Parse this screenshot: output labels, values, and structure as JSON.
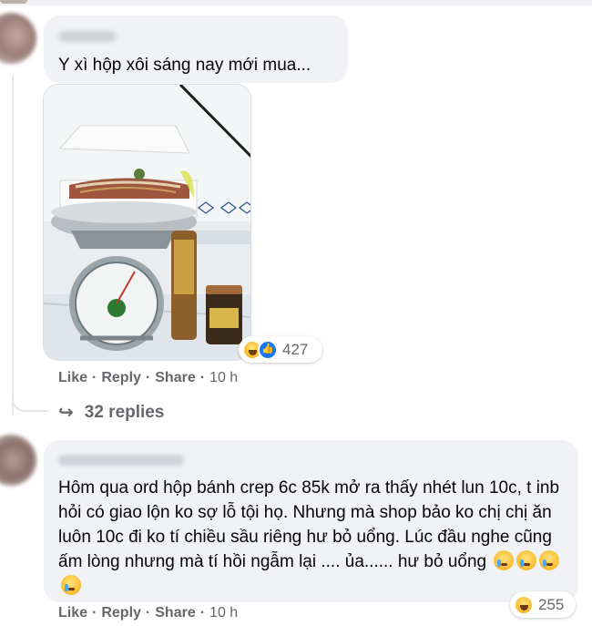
{
  "comments": [
    {
      "text": "Y xì hộp xôi sáng nay mới mua...",
      "reaction_count": "427",
      "reactions": [
        "haha-icon",
        "like-icon"
      ],
      "actions": {
        "like": "Like",
        "reply": "Reply",
        "share": "Share",
        "time": "10 h"
      },
      "replies_label": "32 replies"
    },
    {
      "text": "Hôm qua ord hộp bánh crep 6c 85k mở ra thấy nhét lun 10c, t inb hỏi có giao lộn ko sợ lỗ tội họ. Nhưng mà shop bảo ko chị chị ăn luôn 10c đi ko tí chiều sầu riêng hư bỏ uổng. Lúc đầu nghe cũng ấm lòng nhưng mà tí hồi ngẫm lại .... ủa...... hư bỏ uổng",
      "trailing_emoji": [
        "crying-face-icon",
        "crying-face-icon",
        "crying-face-icon",
        "crying-face-icon"
      ],
      "reaction_count": "255",
      "reactions": [
        "haha-icon"
      ],
      "actions": {
        "like": "Like",
        "reply": "Reply",
        "share": "Share",
        "time": "10 h"
      }
    }
  ],
  "dot": "·",
  "colors": {
    "bubble": "#f0f2f5",
    "meta": "#65676b",
    "text": "#050505",
    "like_blue": "#1877f2",
    "haha_yellow": "#f7b928"
  }
}
